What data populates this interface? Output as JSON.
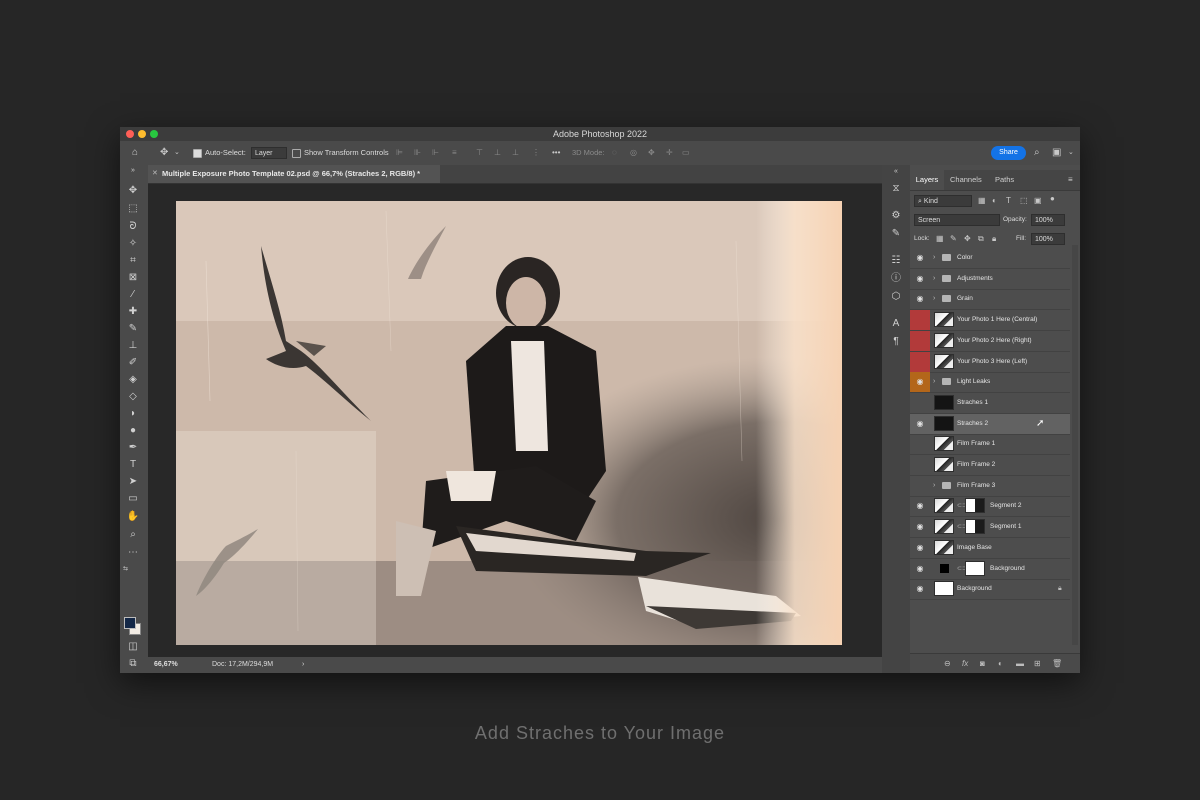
{
  "app": {
    "title": "Adobe Photoshop 2022"
  },
  "options": {
    "auto_select_label": "Auto-Select:",
    "auto_select_target": "Layer",
    "show_transform_label": "Show Transform Controls",
    "mode_3d": "3D Mode:",
    "share_label": "Share"
  },
  "document": {
    "tab_title": "Multiple Exposure Photo Template 02.psd @ 66,7% (Straches 2, RGB/8) *"
  },
  "status": {
    "zoom": "66,67%",
    "doc": "Doc: 17,2M/294,9M",
    "arrow": "›"
  },
  "layers_panel": {
    "tabs": [
      "Layers",
      "Channels",
      "Paths"
    ],
    "filter_kind": "Kind",
    "blend_mode": "Screen",
    "opacity_label": "Opacity:",
    "opacity_value": "100%",
    "lock_label": "Lock:",
    "fill_label": "Fill:",
    "fill_value": "100%",
    "layers": [
      {
        "name": "Color",
        "type": "group",
        "visible": true
      },
      {
        "name": "Adjustments",
        "type": "group",
        "visible": true
      },
      {
        "name": "Grain",
        "type": "group",
        "visible": true
      },
      {
        "name": "Your Photo 1 Here (Central)",
        "type": "smart",
        "color_tag": "#b23a3a",
        "visible": false
      },
      {
        "name": "Your Photo 2 Here (Right)",
        "type": "smart",
        "color_tag": "#b23a3a",
        "visible": false
      },
      {
        "name": "Your Photo 3 Here (Left)",
        "type": "smart",
        "color_tag": "#b23a3a",
        "visible": false
      },
      {
        "name": "Light Leaks",
        "type": "group",
        "color_tag": "#b3661a",
        "visible": true
      },
      {
        "name": "Straches 1",
        "type": "dark",
        "visible": false
      },
      {
        "name": "Straches 2",
        "type": "dark",
        "visible": true,
        "selected": true
      },
      {
        "name": "Film Frame 1",
        "type": "smart",
        "visible": false
      },
      {
        "name": "Film Frame 2",
        "type": "smart",
        "visible": false
      },
      {
        "name": "Film Frame 3",
        "type": "group",
        "visible": false
      },
      {
        "name": "Segment 2",
        "type": "masked",
        "visible": true
      },
      {
        "name": "Segment 1",
        "type": "masked",
        "visible": true
      },
      {
        "name": "Image Base",
        "type": "smart",
        "visible": true
      },
      {
        "name": "Background",
        "type": "adjust",
        "visible": true
      },
      {
        "name": "Background",
        "type": "white",
        "visible": true,
        "locked": true
      }
    ]
  },
  "caption": "Add Straches to Your Image",
  "colors": {
    "accent": "#1473e6",
    "red_tag": "#b23a3a",
    "orange_tag": "#b3661a"
  },
  "icons": [
    "home-icon",
    "move-tool-icon",
    "search-icon",
    "panel-icon",
    "eye-icon",
    "folder-icon",
    "lock-icon",
    "trash-icon"
  ]
}
